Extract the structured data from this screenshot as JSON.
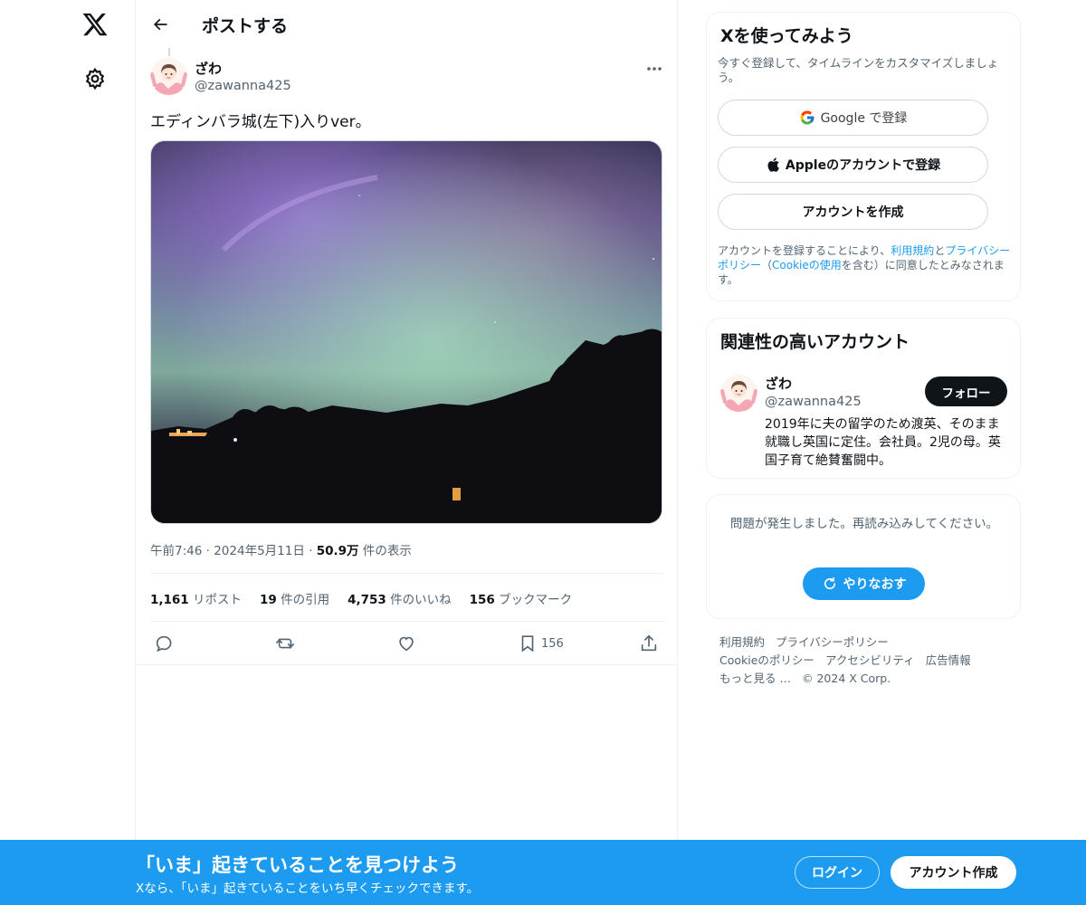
{
  "header": {
    "title": "ポストする"
  },
  "post": {
    "author_name": "ざわ",
    "author_handle": "@zawanna425",
    "text": "エディンバラ城(左下)入りver。",
    "time": "午前7:46",
    "date": "2024年5月11日",
    "views_count": "50.9万",
    "views_label": "件の表示",
    "stats": {
      "reposts_count": "1,161",
      "reposts_label": "リポスト",
      "quotes_count": "19",
      "quotes_label": "件の引用",
      "likes_count": "4,753",
      "likes_label": "件のいいね",
      "bookmarks_count": "156",
      "bookmarks_label": "ブックマーク"
    },
    "bookmark_action_count": "156"
  },
  "signup": {
    "title": "Xを使ってみよう",
    "subtitle": "今すぐ登録して、タイムラインをカスタマイズしましょう。",
    "google_label": "Google で登録",
    "apple_label": "Appleのアカウントで登録",
    "create_label": "アカウントを作成",
    "legal_prefix": "アカウントを登録することにより、",
    "legal_terms": "利用規約",
    "legal_and": "と",
    "legal_privacy": "プライバシーポリシー",
    "legal_mid": "（",
    "legal_cookie": "Cookieの使用",
    "legal_suffix": "を含む）に同意したとみなされます。"
  },
  "related": {
    "title": "関連性の高いアカウント",
    "name": "ざわ",
    "handle": "@zawanna425",
    "follow_label": "フォロー",
    "bio": "2019年に夫の留学のため渡英、そのまま就職し英国に定住。会社員。2児の母。英国子育て絶賛奮闘中。"
  },
  "error": {
    "text": "問題が発生しました。再読み込みしてください。",
    "retry_label": "やりなおす"
  },
  "footer": {
    "terms": "利用規約",
    "privacy": "プライバシーポリシー",
    "cookie": "Cookieのポリシー",
    "accessibility": "アクセシビリティ",
    "ads": "広告情報",
    "more": "もっと見る …",
    "copyright": "© 2024 X Corp."
  },
  "banner": {
    "title": "「いま」起きていることを見つけよう",
    "subtitle": "Xなら、「いま」起きていることをいち早くチェックできます。",
    "login_label": "ログイン",
    "create_label": "アカウント作成"
  },
  "colors": {
    "accent": "#1d9bf0",
    "text_primary": "#0f1419",
    "text_secondary": "#536471"
  }
}
